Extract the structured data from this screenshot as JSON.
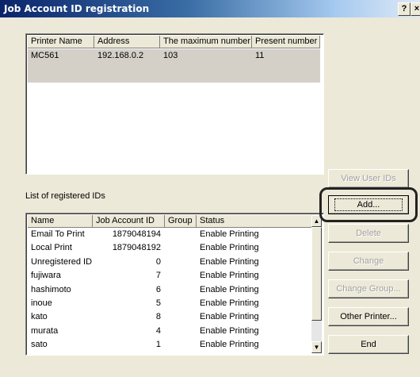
{
  "window": {
    "title": "Job Account ID registration",
    "help_btn": "?",
    "close_btn": "×"
  },
  "printers": {
    "headers": [
      "Printer Name",
      "Address",
      "The maximum number",
      "Present number"
    ],
    "rows": [
      {
        "name": "MC561",
        "address": "192.168.0.2",
        "max": "103",
        "present": "11"
      }
    ]
  },
  "registered_label": "List of registered IDs",
  "ids": {
    "headers": [
      "Name",
      "Job Account ID",
      "Group",
      "Status"
    ],
    "rows": [
      {
        "name": "Email To Print",
        "id": "1879048194",
        "group": "",
        "status": "Enable Printing"
      },
      {
        "name": "Local Print",
        "id": "1879048192",
        "group": "",
        "status": "Enable Printing"
      },
      {
        "name": "Unregistered ID",
        "id": "0",
        "group": "",
        "status": "Enable Printing"
      },
      {
        "name": "fujiwara",
        "id": "7",
        "group": "",
        "status": "Enable Printing"
      },
      {
        "name": "hashimoto",
        "id": "6",
        "group": "",
        "status": "Enable Printing"
      },
      {
        "name": "inoue",
        "id": "5",
        "group": "",
        "status": "Enable Printing"
      },
      {
        "name": "kato",
        "id": "8",
        "group": "",
        "status": "Enable Printing"
      },
      {
        "name": "murata",
        "id": "4",
        "group": "",
        "status": "Enable Printing"
      },
      {
        "name": "sato",
        "id": "1",
        "group": "",
        "status": "Enable Printing"
      }
    ]
  },
  "buttons": {
    "view_user_ids": "View User IDs",
    "add": "Add...",
    "delete": "Delete",
    "change": "Change",
    "change_group": "Change Group...",
    "other_printer": "Other Printer...",
    "end": "End"
  }
}
